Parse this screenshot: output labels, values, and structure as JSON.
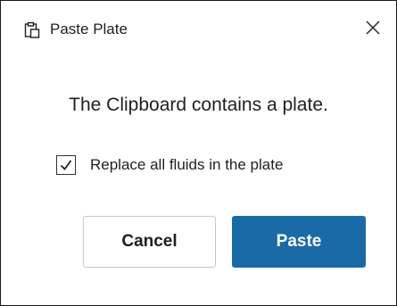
{
  "dialog": {
    "title": "Paste Plate",
    "app_icon": "clipboard-paste-icon",
    "close_icon": "close-icon",
    "message": "The Clipboard contains a plate.",
    "replace_option": {
      "label": "Replace all fluids in the plate",
      "checked": true
    },
    "buttons": {
      "cancel_label": "Cancel",
      "paste_label": "Paste"
    },
    "colors": {
      "primary_button": "#1a6aa8",
      "primary_text": "#ffffff",
      "border": "#1a1a1a"
    }
  }
}
